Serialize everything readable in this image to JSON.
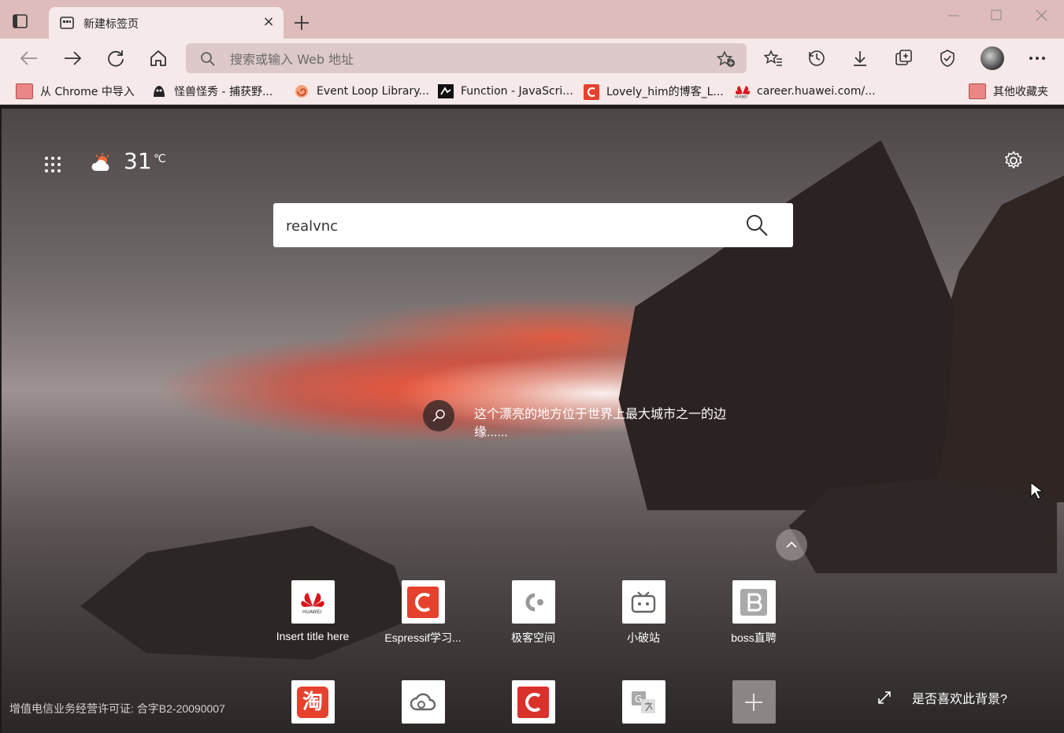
{
  "tab": {
    "title": "新建标签页",
    "close_glyph": "×"
  },
  "address_bar": {
    "placeholder": "搜索或输入 Web 地址"
  },
  "bookmarks": [
    {
      "label": "从 Chrome 中导入",
      "icon": "folder-icon"
    },
    {
      "label": "怪兽怪秀 - 捕获野...",
      "icon": "monster-icon"
    },
    {
      "label": "Event Loop Library...",
      "icon": "spiral-icon"
    },
    {
      "label": "Function - JavaScri...",
      "icon": "mdn-icon"
    },
    {
      "label": "Lovely_him的博客_L...",
      "icon": "csdn-icon"
    },
    {
      "label": "career.huawei.com/...",
      "icon": "huawei-icon"
    }
  ],
  "other_bookmarks": {
    "label": "其他收藏夹"
  },
  "weather": {
    "temperature": "31",
    "unit": "℃"
  },
  "search": {
    "value": "realvnc"
  },
  "image_info": {
    "text": "这个漂亮的地方位于世界上最大城市之一的边缘......"
  },
  "quick_links_row1": [
    {
      "label": "Insert title here",
      "icon": "huawei-icon"
    },
    {
      "label": "Espressif学习...",
      "icon": "csdn-icon"
    },
    {
      "label": "极客空间",
      "icon": "geek-icon"
    },
    {
      "label": "小破站",
      "icon": "bilibili-icon"
    },
    {
      "label": "boss直聘",
      "icon": "boss-icon"
    }
  ],
  "quick_links_row2": [
    {
      "icon": "taobao-icon",
      "glyph": "淘"
    },
    {
      "icon": "cloud-icon"
    },
    {
      "icon": "csdn-icon"
    },
    {
      "icon": "translate-icon"
    },
    {
      "icon": "add-icon"
    }
  ],
  "footer": {
    "license": "增值电信业务经营许可证: 合字B2-20090007",
    "like_background": "是否喜欢此背景?"
  },
  "colors": {
    "accent_red": "#e5412d",
    "tab_strip": "#dfbcbc",
    "toolbar": "#f6e9e9"
  }
}
